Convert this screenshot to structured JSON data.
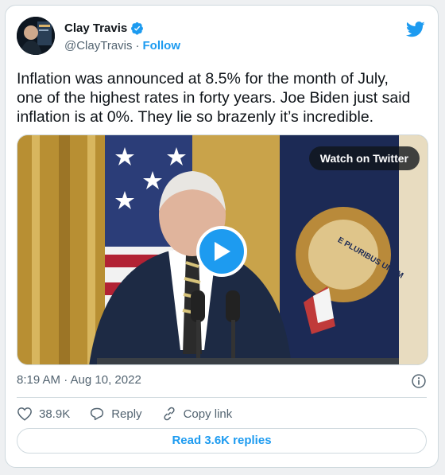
{
  "author": {
    "name": "Clay Travis",
    "handle": "@ClayTravis",
    "separator": "·",
    "follow_label": "Follow",
    "verified": true,
    "verified_icon": "verified-badge-icon"
  },
  "brand_icon": "twitter-bird-icon",
  "tweet": {
    "text": "Inflation was announced at 8.5% for the month of July,\none of the highest rates in forty years. Joe Biden just said\ninflation is at 0%. They lie so brazenly it’s incredible."
  },
  "media": {
    "watch_label": "Watch on Twitter",
    "play_icon": "play-icon",
    "seal_text": "E PLURIBUS UNUM"
  },
  "meta": {
    "timestamp": "8:19 AM · Aug 10, 2022",
    "info_icon": "info-icon"
  },
  "actions": {
    "likes": "38.9K",
    "reply_label": "Reply",
    "copy_label": "Copy link"
  },
  "read_replies_label": "Read 3.6K replies",
  "colors": {
    "accent": "#1d9bf0",
    "text": "#0f1419",
    "secondary": "#536471",
    "border": "#cfd9de"
  }
}
